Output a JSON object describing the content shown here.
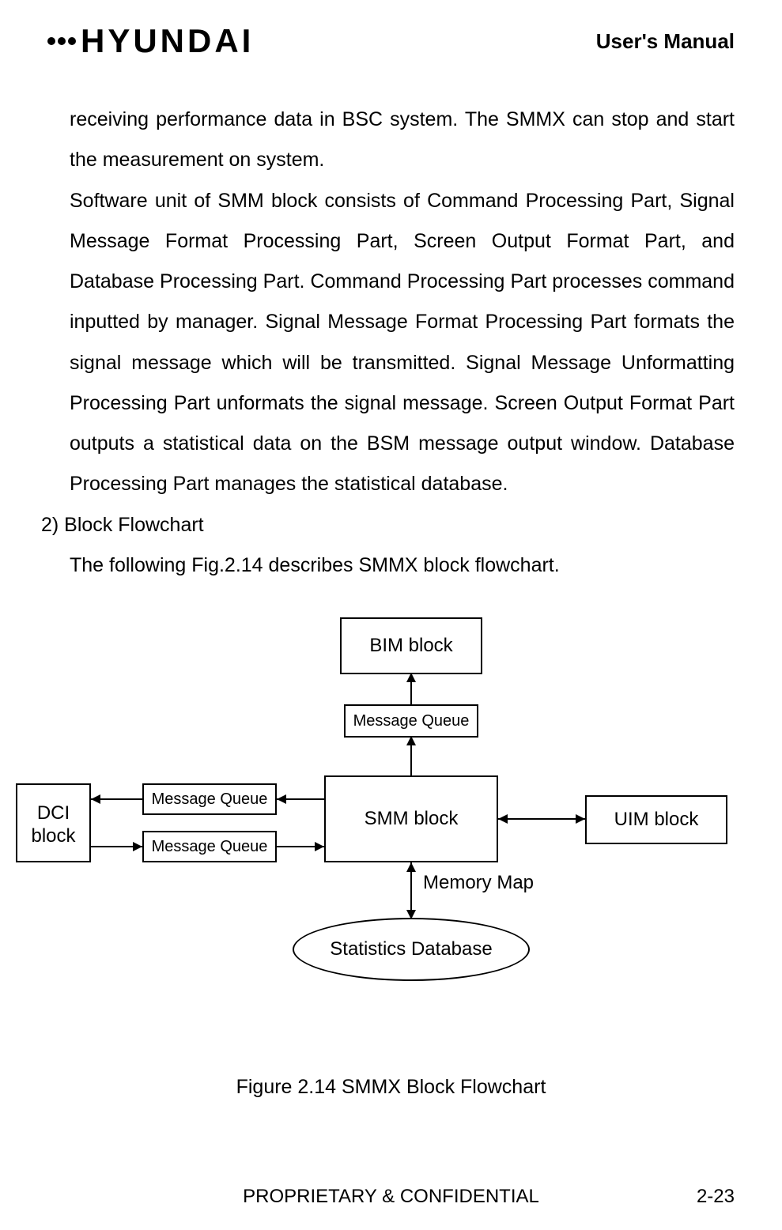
{
  "header": {
    "brand": "HYUNDAI",
    "manual_title": "User's Manual"
  },
  "paragraphs": {
    "p1": "receiving performance data in BSC system. The SMMX can stop and start the measurement on system.",
    "p2": "Software unit of SMM block consists of Command Processing Part, Signal Message Format Processing Part, Screen Output Format Part, and Database Processing Part. Command Processing Part processes command inputted by manager. Signal Message Format Processing Part formats the signal message which will be transmitted. Signal Message Unformatting Processing Part unformats the signal message. Screen Output Format Part outputs a statistical data on the BSM message output window. Database Processing Part manages the statistical database."
  },
  "section_heading": "2) Block Flowchart",
  "section_intro": "The following Fig.2.14 describes SMMX block flowchart.",
  "diagram": {
    "bim": "BIM block",
    "smm": "SMM block",
    "uim": "UIM block",
    "dci": "DCI block",
    "mq": "Message Queue",
    "memory_map": "Memory Map",
    "stats_db": "Statistics  Database"
  },
  "figure_caption": "Figure 2.14 SMMX Block Flowchart",
  "footer": "PROPRIETARY & CONFIDENTIAL",
  "page_number": "2-23"
}
